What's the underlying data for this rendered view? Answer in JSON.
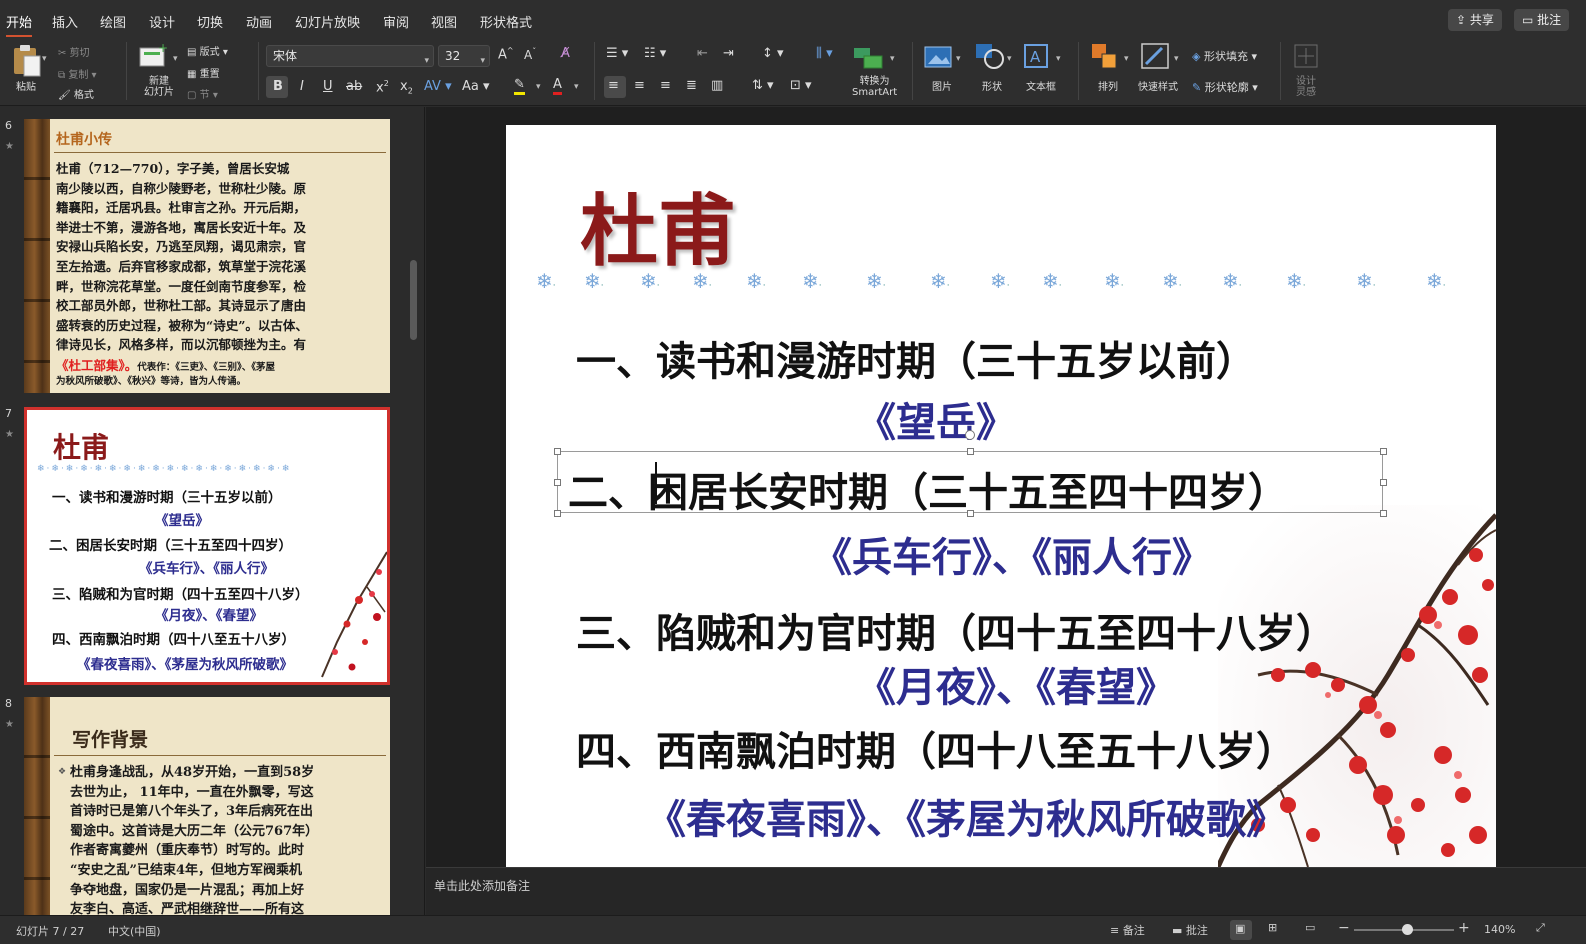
{
  "tabs": [
    "开始",
    "插入",
    "绘图",
    "设计",
    "切换",
    "动画",
    "幻灯片放映",
    "审阅",
    "视图",
    "形状格式"
  ],
  "top_buttons": {
    "share": "共享",
    "comments": "批注"
  },
  "ribbon": {
    "paste": "粘贴",
    "cut": "剪切",
    "copy": "复制",
    "format": "格式",
    "new_slide": "新建\n幻灯片",
    "layout": "版式",
    "reset": "重置",
    "section": "节",
    "font_name": "宋体",
    "font_size": "32",
    "convert_smartart": "转换为\nSmartArt",
    "picture": "图片",
    "shape": "形状",
    "textbox": "文本框",
    "arrange": "排列",
    "quick_styles": "快速样式",
    "shape_fill": "形状填充",
    "shape_outline": "形状轮廓",
    "design_ideas": "设计\n灵感"
  },
  "thumbnails": {
    "s6": {
      "number": "6",
      "title": "杜甫小传",
      "lines": [
        "杜甫（712—770），字子美，曾居长安城",
        "南少陵以西，自称少陵野老，世称杜少陵。原",
        "籍襄阳，迁居巩县。杜审言之孙。开元后期，",
        "举进士不第，漫游各地，寓居长安近十年。及",
        "安禄山兵陷长安，乃逃至凤翔，谒见肃宗，官",
        "至左拾遗。后弃官移家成都，筑草堂于浣花溪",
        "畔，世称浣花草堂。一度任剑南节度参军，检",
        "校工部员外郎，世称杜工部。其诗显示了唐由",
        "盛转衰的历史过程，被称为“诗史”。以古体、",
        "律诗见长，风格多样，而以沉郁顿挫为主。有"
      ],
      "last_line_red": "《杜工部集》。",
      "last_line_small": "代表作：《三吏》、《三别》、《茅屋",
      "final_line": "为秋风所破歌》、《秋兴》等诗，皆为人传诵。"
    },
    "s7": {
      "number": "7",
      "title": "杜甫",
      "items": [
        "一、读书和漫游时期（三十五岁以前）",
        "《望岳》",
        "二、困居长安时期（三十五至四十四岁）",
        "《兵车行》、《丽人行》",
        "三、陷贼和为官时期（四十五至四十八岁）",
        "《月夜》、《春望》",
        "四、西南飘泊时期（四十八至五十八岁）",
        "《春夜喜雨》、《茅屋为秋风所破歌》"
      ]
    },
    "s8": {
      "number": "8",
      "title": "写作背景",
      "lines": [
        "杜甫身逢战乱，从48岁开始，一直到58岁",
        "去世为止， 11年中，一直在外飘零，写这",
        "首诗时已是第八个年头了，3年后病死在出",
        "蜀途中。这首诗是大历二年（公元767年）",
        "作者寄寓夔州（重庆奉节）时写的。此时",
        "“安史之乱”已结束4年，但地方军阀乘机",
        "争夺地盘，国家仍是一片混乱；再加上好",
        "友李白、高适、严武相继辞世——所有这"
      ]
    }
  },
  "slide": {
    "title": "杜甫",
    "periods": [
      {
        "heading": "一、读书和漫游时期（三十五岁以前）",
        "poems": "《望岳》"
      },
      {
        "heading": "二、困居长安时期（三十五至四十四岁）",
        "poems": "《兵车行》、《丽人行》"
      },
      {
        "heading": "三、陷贼和为官时期（四十五至四十八岁）",
        "poems": "《月夜》、《春望》"
      },
      {
        "heading": "四、西南飘泊时期（四十八至五十八岁）",
        "poems": "《春夜喜雨》、《茅屋为秋风所破歌》"
      }
    ]
  },
  "notes_placeholder": "单击此处添加备注",
  "status": {
    "slide_counter": "幻灯片 7 / 27",
    "language": "中文(中国)",
    "notes": "备注",
    "comments": "批注",
    "zoom": "140%"
  },
  "colors": {
    "accent": "#d35230",
    "title_red": "#8b1a1a",
    "poem_blue": "#2d2d8f",
    "thumb_red": "#e02020"
  }
}
